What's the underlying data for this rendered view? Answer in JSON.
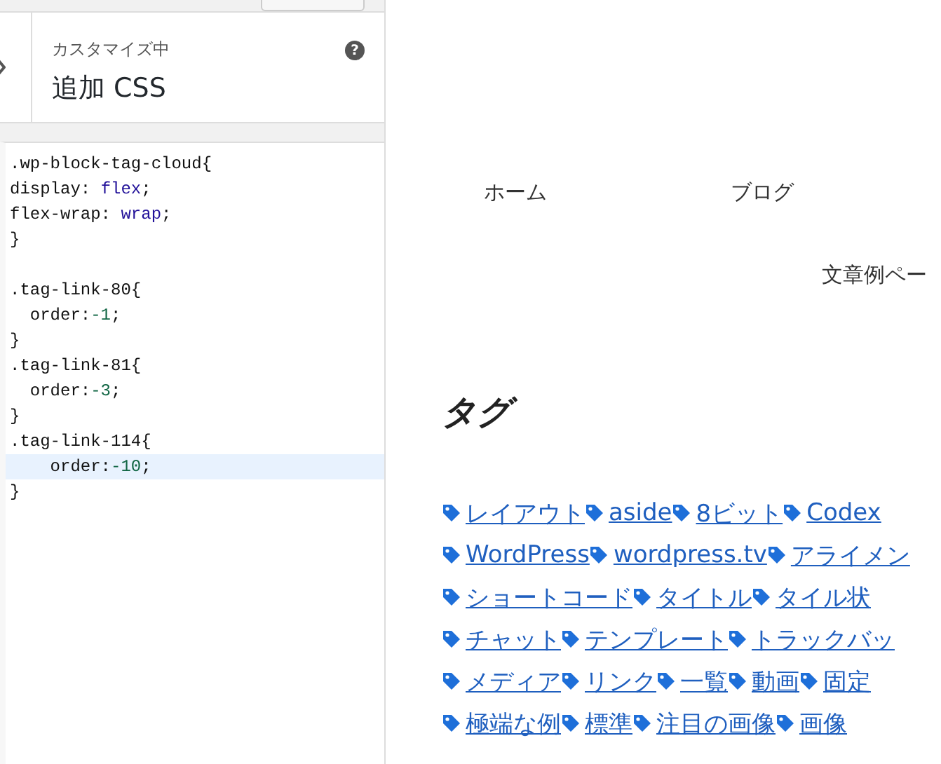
{
  "sidebar": {
    "header": {
      "subtitle": "カスタマイズ中",
      "title": "追加 CSS",
      "help": "?"
    },
    "editor": {
      "lines": [
        {
          "kind": "code",
          "active": false,
          "tokens": [
            {
              "text": ".wp-block-tag-cloud{",
              "kind": "plain"
            }
          ]
        },
        {
          "kind": "code",
          "active": false,
          "tokens": [
            {
              "text": "display: ",
              "kind": "plain"
            },
            {
              "text": "flex",
              "kind": "keyword"
            },
            {
              "text": ";",
              "kind": "plain"
            }
          ]
        },
        {
          "kind": "code",
          "active": false,
          "tokens": [
            {
              "text": "flex-wrap: ",
              "kind": "plain"
            },
            {
              "text": "wrap",
              "kind": "keyword"
            },
            {
              "text": ";",
              "kind": "plain"
            }
          ]
        },
        {
          "kind": "code",
          "active": false,
          "tokens": [
            {
              "text": "}",
              "kind": "plain"
            }
          ]
        },
        {
          "kind": "blank"
        },
        {
          "kind": "code",
          "active": false,
          "tokens": [
            {
              "text": ".tag-link-80{",
              "kind": "plain"
            }
          ]
        },
        {
          "kind": "code",
          "active": false,
          "tokens": [
            {
              "text": "  order:",
              "kind": "plain"
            },
            {
              "text": "-1",
              "kind": "number"
            },
            {
              "text": ";",
              "kind": "plain"
            }
          ]
        },
        {
          "kind": "code",
          "active": false,
          "tokens": [
            {
              "text": "}",
              "kind": "plain"
            }
          ]
        },
        {
          "kind": "code",
          "active": false,
          "tokens": [
            {
              "text": ".tag-link-81{",
              "kind": "plain"
            }
          ]
        },
        {
          "kind": "code",
          "active": false,
          "tokens": [
            {
              "text": "  order:",
              "kind": "plain"
            },
            {
              "text": "-3",
              "kind": "number"
            },
            {
              "text": ";",
              "kind": "plain"
            }
          ]
        },
        {
          "kind": "code",
          "active": false,
          "tokens": [
            {
              "text": "}",
              "kind": "plain"
            }
          ]
        },
        {
          "kind": "code",
          "active": false,
          "tokens": [
            {
              "text": ".tag-link-114{",
              "kind": "plain"
            }
          ]
        },
        {
          "kind": "code",
          "active": true,
          "tokens": [
            {
              "text": "    order:",
              "kind": "plain"
            },
            {
              "text": "-10",
              "kind": "number"
            },
            {
              "text": ";",
              "kind": "plain"
            }
          ]
        },
        {
          "kind": "code",
          "active": false,
          "tokens": [
            {
              "text": "}",
              "kind": "plain"
            }
          ]
        }
      ]
    }
  },
  "preview": {
    "nav": [
      "ホーム",
      "ブログ"
    ],
    "subnav": [
      "文章例ペー"
    ],
    "heading": "タグ",
    "tag_rows": [
      [
        "レイアウト",
        "aside",
        "8ビット",
        "Codex"
      ],
      [
        "WordPress",
        "wordpress.tv",
        "アライメン"
      ],
      [
        "ショートコード",
        "タイトル",
        "タイル状"
      ],
      [
        "チャット",
        "テンプレート",
        "トラックバッ"
      ],
      [
        "メディア",
        "リンク",
        "一覧",
        "動画",
        "固定"
      ],
      [
        "極端な例",
        "標準",
        "注目の画像",
        "画像"
      ]
    ]
  }
}
